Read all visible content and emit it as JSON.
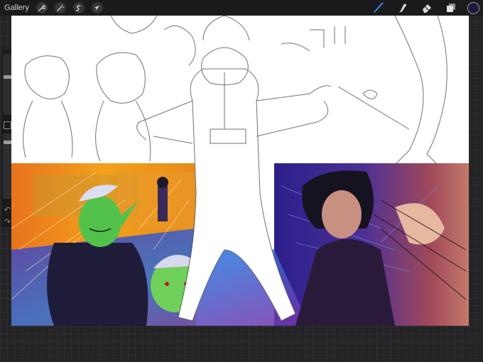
{
  "topbar": {
    "gallery_label": "Gallery",
    "left_tools": [
      "wrench-icon",
      "magic-wand-icon",
      "selection-icon",
      "transform-arrow-icon"
    ],
    "right_tools": [
      "brush-icon",
      "smudge-icon",
      "eraser-icon",
      "layers-icon"
    ],
    "current_color": "#1c1a3a"
  },
  "sidebar": {
    "controls": [
      "brush-size-slider",
      "modify-button",
      "opacity-slider",
      "undo-button",
      "redo-button"
    ],
    "undo_glyph": "↶",
    "redo_glyph": "↷"
  },
  "colors": {
    "topbar_bg": "#1b1b1d",
    "workspace_bg": "#242426",
    "active_tool": "#3b8cf0",
    "canvas_bg": "#ffffff"
  }
}
